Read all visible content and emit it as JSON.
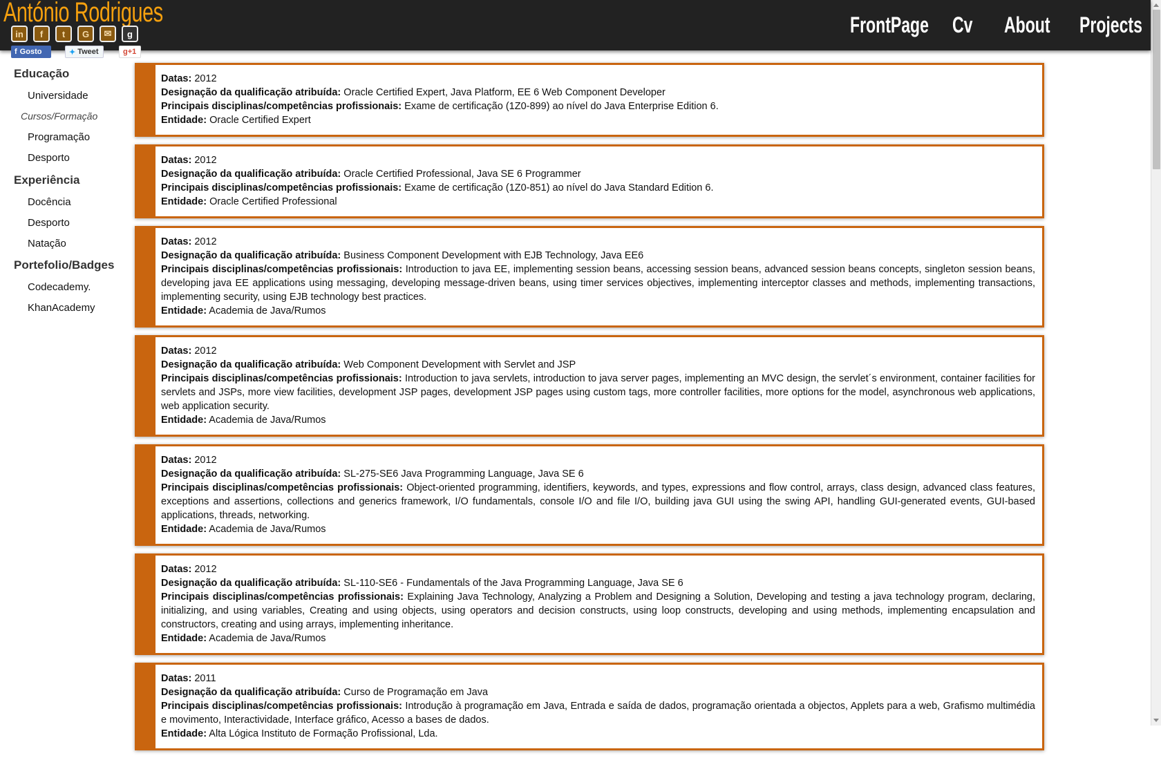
{
  "header": {
    "title": "António Rodrigues",
    "social": [
      {
        "icon": "linkedin-icon",
        "glyph": "in"
      },
      {
        "icon": "facebook-icon",
        "glyph": "f"
      },
      {
        "icon": "twitter-icon",
        "glyph": "t"
      },
      {
        "icon": "google-icon",
        "glyph": "G"
      },
      {
        "icon": "email-icon",
        "glyph": "✉"
      },
      {
        "icon": "goodreads-icon",
        "glyph": "g"
      }
    ],
    "share": {
      "facebook": "Gosto",
      "tweet": "Tweet",
      "gplus": "g+1"
    },
    "nav": [
      "FrontPage",
      "Cv",
      "About",
      "Projects"
    ]
  },
  "sidebar": {
    "educacao": "Educação",
    "universidade": "Universidade",
    "cursos": "Cursos/Formação",
    "programacao": "Programação",
    "desporto1": "Desporto",
    "experiencia": "Experiência",
    "docencia": "Docência",
    "desporto2": "Desporto",
    "natacao": "Natação",
    "portefolio": "Portefolio/Badges",
    "codecademy": "Codecademy.",
    "khan": "KhanAcademy"
  },
  "labels": {
    "datas": "Datas:",
    "designacao": "Designação da qualificação atribuída:",
    "principais": "Principais disciplinas/competências profissionais:",
    "entidade": "Entidade:"
  },
  "accent": "#c9650f",
  "cards": [
    {
      "datas": "2012",
      "designacao": "Oracle Certified Expert, Java Platform, EE 6 Web Component Developer",
      "principais": "Exame de certificação (1Z0-899) ao nível do Java Enterprise Edition 6.",
      "entidade": "Oracle Certified Expert"
    },
    {
      "datas": "2012",
      "designacao": "Oracle Certified Professional, Java SE 6 Programmer",
      "principais": "Exame de certificação (1Z0-851) ao nível do Java Standard Edition 6.",
      "entidade": "Oracle Certified Professional"
    },
    {
      "datas": "2012",
      "designacao": "Business Component Development with EJB Technology, Java EE6",
      "principais": "Introduction to java EE, implementing session beans, accessing session beans, advanced session beans concepts, singleton session beans, developing java EE applications using messaging, developing message-driven beans, using timer services objectives, implementing interceptor classes and methods, implementing transactions, implementing security, using EJB technology best practices.",
      "entidade": "Academia de Java/Rumos"
    },
    {
      "datas": "2012",
      "designacao": "Web Component Development with Servlet and JSP",
      "principais": "Introduction to java servlets, introduction to java server pages, implementing an MVC design, the servlet´s environment, container facilities for servlets and JSPs, more view facilities, development JSP pages, development JSP pages using custom tags, more controller facilities, more options for the model, asynchronous web applications, web application security.",
      "entidade": "Academia de Java/Rumos"
    },
    {
      "datas": "2012",
      "designacao": "SL-275-SE6 Java Programming Language, Java SE 6",
      "principais": "Object-oriented programming, identifiers, keywords, and types, expressions and flow control, arrays, class design, advanced class features, exceptions and assertions, collections and generics framework, I/O fundamentals, console I/O and file I/O, building java GUI using the swing API, handling GUI-generated events, GUI-based applications, threads, networking.",
      "entidade": "Academia de Java/Rumos"
    },
    {
      "datas": "2012",
      "designacao": "SL-110-SE6 - Fundamentals of the Java Programming Language, Java SE 6",
      "principais": "Explaining Java Technology, Analyzing a Problem and Designing a Solution, Developing and testing a java technology program, declaring, initializing, and using variables, Creating and using objects, using operators and decision constructs, using loop constructs, developing and using methods, implementing encapsulation and constructors, creating and using arrays, implementing inheritance.",
      "entidade": "Academia de Java/Rumos"
    },
    {
      "datas": "2011",
      "designacao": "Curso de Programação em Java",
      "principais": "Introdução à programação em Java, Entrada e saída de dados, programação orientada a objectos, Applets para a web, Grafismo multimédia e movimento, Interactividade, Interface gráfico, Acesso a bases de dados.",
      "entidade": "Alta Lógica Instituto de Formação Profissional, Lda."
    }
  ]
}
